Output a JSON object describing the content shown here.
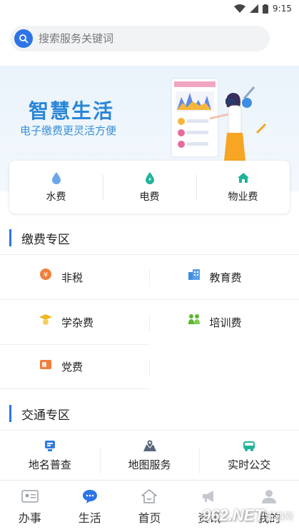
{
  "status_bar": {
    "time": "9:15"
  },
  "search": {
    "placeholder": "搜索服务关键词"
  },
  "banner": {
    "title": "智慧生活",
    "subtitle": "电子缴费更灵活方便"
  },
  "fees": [
    {
      "label": "水费",
      "icon": "water-drop-icon",
      "color": "#4a90e2"
    },
    {
      "label": "电费",
      "icon": "electric-drop-icon",
      "color": "#1fb49a"
    },
    {
      "label": "物业费",
      "icon": "house-icon",
      "color": "#1fb49a"
    }
  ],
  "payment_section": {
    "title": "缴费专区",
    "items": [
      {
        "label": "非税",
        "icon": "tax-coin-icon",
        "color": "#f07f3c"
      },
      {
        "label": "教育费",
        "icon": "school-building-icon",
        "color": "#3f8de0"
      },
      {
        "label": "学杂费",
        "icon": "graduation-cap-icon",
        "color": "#f0b71f"
      },
      {
        "label": "培训费",
        "icon": "training-people-icon",
        "color": "#5cb531"
      },
      {
        "label": "党费",
        "icon": "party-badge-icon",
        "color": "#f07f3c"
      }
    ]
  },
  "traffic_section": {
    "title": "交通专区",
    "items": [
      {
        "label": "地名普查",
        "icon": "place-survey-icon",
        "color": "#2f7ce0"
      },
      {
        "label": "地图服务",
        "icon": "map-pin-icon",
        "color": "#5a6578"
      },
      {
        "label": "实时公交",
        "icon": "bus-icon",
        "color": "#1fb49a"
      }
    ]
  },
  "tabbar": [
    {
      "label": "办事",
      "icon": "id-card-icon"
    },
    {
      "label": "生活",
      "icon": "chat-bubble-icon",
      "active": true
    },
    {
      "label": "首页",
      "icon": "home-icon"
    },
    {
      "label": "资讯",
      "icon": "megaphone-icon"
    },
    {
      "label": "我的",
      "icon": "user-icon"
    }
  ],
  "watermark": {
    "logo": "962.NET",
    "sub": "乐游网"
  },
  "colors": {
    "accent": "#2e74e6",
    "banner_text": "#2a86d8"
  }
}
